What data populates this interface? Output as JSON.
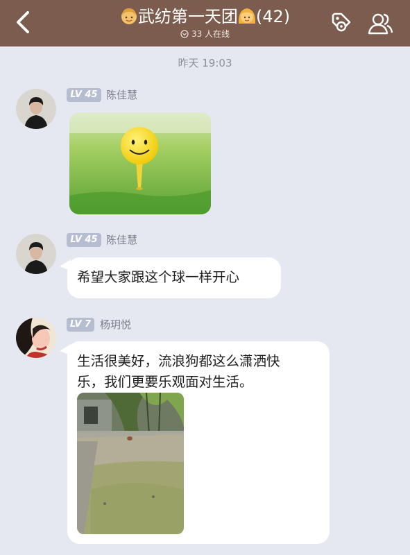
{
  "header": {
    "group_name": "武纺第一天团",
    "member_count": "(42)",
    "online_text": "33 人在线",
    "bg_color": "#7b5c4e",
    "left_emoji": "boy-emoji",
    "right_emoji": "girl-emoji",
    "icons": [
      "back-icon",
      "tag-settings-icon",
      "members-icon"
    ]
  },
  "timestamp": "昨天 19:03",
  "messages": [
    {
      "level": "LV 45",
      "sender": "陈佳慧",
      "type": "image",
      "image": "golf-ball-smiley"
    },
    {
      "level": "LV 45",
      "sender": "陈佳慧",
      "type": "text",
      "text": "希望大家跟这个球一样开心"
    },
    {
      "level": "LV 7",
      "sender": "杨玥悦",
      "type": "text+image",
      "text_line1": "生活很美好，流浪狗都这么潇洒快",
      "text_line2": "乐，我们更要乐观面对生活。",
      "image": "courtyard-dog-photo"
    }
  ]
}
